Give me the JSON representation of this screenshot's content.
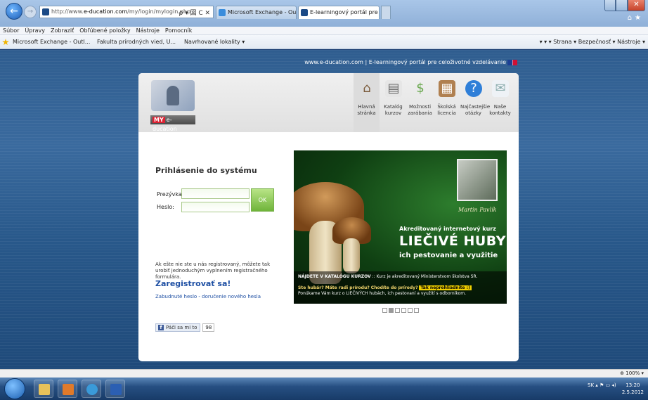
{
  "browser": {
    "address_url_prefix": "http://www.",
    "address_url_main": "e-ducation.com",
    "address_url_path": "/my/login/mylogin.php",
    "address_tools": "ρ ▾ 図 C ✕",
    "tabs": [
      {
        "label": "Microsoft Exchange - Outlook ..."
      },
      {
        "label": "E-learningový portál pre cel... ✕"
      }
    ],
    "menu": [
      "Súbor",
      "Úpravy",
      "Zobraziť",
      "Obľúbené položky",
      "Nástroje",
      "Pomocník"
    ],
    "favorites": [
      "Microsoft Exchange - Outl...",
      "Fakulta prírodných vied, U...",
      "Navrhované lokality ▾"
    ],
    "commandbar": "▾ ▾ ▾ Strana ▾ Bezpečnosť ▾ Nástroje ▾",
    "zoom": "100%"
  },
  "site": {
    "top_strip": "www.e-ducation.com | E-learningový portál pre celoživotné vzdelávanie",
    "logo_my": "MY",
    "logo_name": "e-ducation",
    "nav": [
      {
        "label": "Hlavná stránka",
        "icon": "home-icon"
      },
      {
        "label": "Katalóg kurzov",
        "icon": "catalog-icon"
      },
      {
        "label": "Možnosti zarábania",
        "icon": "money-icon"
      },
      {
        "label": "Školská licencia",
        "icon": "school-icon"
      },
      {
        "label": "Najčastejšie otázky",
        "icon": "question-icon"
      },
      {
        "label": "Naše kontakty",
        "icon": "contact-icon"
      }
    ],
    "login": {
      "title": "Prihlásenie do systému",
      "username_label": "Prezývka:",
      "password_label": "Heslo:",
      "ok_label": "OK",
      "register_note": "Ak ešte nie ste u nás registrovaný, môžete tak urobiť jednoduchým vyplnením registračného formulára.",
      "register_link": "Zaregistrovať sa!",
      "forgot_link": "Zabudnuté heslo - doručenie nového hesla",
      "like_label": "Páči sa mi to",
      "like_count": "98"
    },
    "banner": {
      "author": "Martin Pavlík",
      "subtitle": "Akreditovaný internetový kurz",
      "title": "LIEČIVÉ HUBY",
      "title2": "ich pestovanie a využitie",
      "info_heading": "NÁJDETE V KATALÓGU KURZOV",
      "info_heading_rest": " :: Kurz je akreditovaný Ministerstvom školstva SR.",
      "question": "Ste hubár? Máte radi prírodu? Chodíte do prírody?",
      "tag": "Tak neprehliadnite :)",
      "offer": "Ponúkame Vám kurz o LIEČIVÝCH hubách, ich pestovaní a využití s odborníkom."
    }
  },
  "taskbar": {
    "lang": "SK",
    "time": "13:20",
    "date": "2.5.2012"
  },
  "colors": {
    "link": "#1e4fa3",
    "ok_button": "#6fb43a",
    "page_bg": "#2f5d8f"
  }
}
